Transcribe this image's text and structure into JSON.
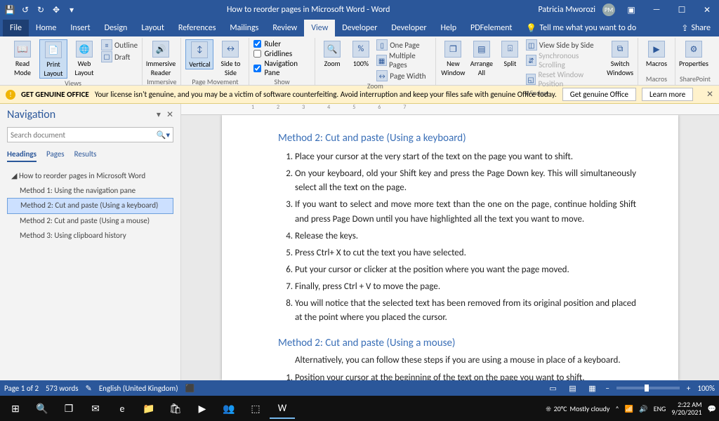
{
  "titlebar": {
    "doc_title": "How to reorder pages in Microsoft Word  -  Word",
    "user_name": "Patricia Mworozi",
    "user_initials": "PM"
  },
  "tabs": {
    "file": "File",
    "items": [
      "Home",
      "Insert",
      "Design",
      "Layout",
      "References",
      "Mailings",
      "Review",
      "View",
      "Developer",
      "Developer",
      "Help",
      "PDFelement"
    ],
    "active_index": 7,
    "tell_me": "Tell me what you want to do",
    "share": "Share"
  },
  "ribbon": {
    "views": {
      "read": "Read Mode",
      "print": "Print Layout",
      "web": "Web Layout",
      "outline": "Outline",
      "draft": "Draft",
      "label": "Views"
    },
    "immersive": {
      "reader": "Immersive Reader",
      "label": "Immersive"
    },
    "page_movement": {
      "vertical": "Vertical",
      "side": "Side to Side",
      "label": "Page Movement"
    },
    "show": {
      "ruler": "Ruler",
      "gridlines": "Gridlines",
      "navpane": "Navigation Pane",
      "label": "Show",
      "ruler_checked": true,
      "gridlines_checked": false,
      "nav_checked": true
    },
    "zoom": {
      "zoom": "Zoom",
      "hundred": "100%",
      "one": "One Page",
      "multi": "Multiple Pages",
      "width": "Page Width",
      "label": "Zoom"
    },
    "window": {
      "new": "New Window",
      "arrange": "Arrange All",
      "split": "Split",
      "side": "View Side by Side",
      "sync": "Synchronous Scrolling",
      "reset": "Reset Window Position",
      "switch": "Switch Windows",
      "label": "Window"
    },
    "macros": {
      "macros": "Macros",
      "label": "Macros"
    },
    "sharepoint": {
      "props": "Properties",
      "label": "SharePoint"
    }
  },
  "warning": {
    "title": "GET GENUINE OFFICE",
    "msg": "Your license isn't genuine, and you may be a victim of software counterfeiting. Avoid interruption and keep your files safe with genuine Office today.",
    "btn1": "Get genuine Office",
    "btn2": "Learn more"
  },
  "nav": {
    "title": "Navigation",
    "search_placeholder": "Search document",
    "tabs": [
      "Headings",
      "Pages",
      "Results"
    ],
    "tree_root": "How to reorder pages in Microsoft Word",
    "tree": [
      "Method 1: Using the navigation pane",
      "Method 2: Cut and paste (Using a keyboard)",
      "Method 2: Cut and paste (Using a mouse)",
      "Method 3: Using clipboard history"
    ],
    "selected_index": 1
  },
  "document": {
    "h1": "Method 2: Cut and paste (Using a keyboard)",
    "list1": [
      "Place your cursor at the very start of the text on the page you want to shift.",
      "On your keyboard, old your Shift key and press the Page Down key. This will simultaneously select all the text on the page.",
      "If you want to select and move more text than the one on the page, continue holding Shift and press Page Down until you have highlighted all the text you want to move.",
      "Release the keys.",
      "Press Ctrl+ X to cut the text you have selected.",
      "Put your cursor or clicker at the position where you want the page moved.",
      "Finally, press Ctrl + V to move the page.",
      "You will notice that the selected text has been removed from its original position and placed at the point where you placed the cursor."
    ],
    "h2": "Method 2: Cut and paste (Using a mouse)",
    "p1": "Alternatively, you can follow these steps if you are using a mouse in place of a keyboard.",
    "list2": [
      "Position your cursor at the beginning of the text on the page you want to shift."
    ]
  },
  "status": {
    "page": "Page 1 of 2",
    "words": "573 words",
    "lang": "English (United Kingdom)",
    "zoom": "100%"
  },
  "taskbar": {
    "weather_temp": "20°C",
    "weather_desc": "Mostly cloudy",
    "lang": "ENG",
    "time": "2:22 AM",
    "date": "9/20/2021"
  }
}
